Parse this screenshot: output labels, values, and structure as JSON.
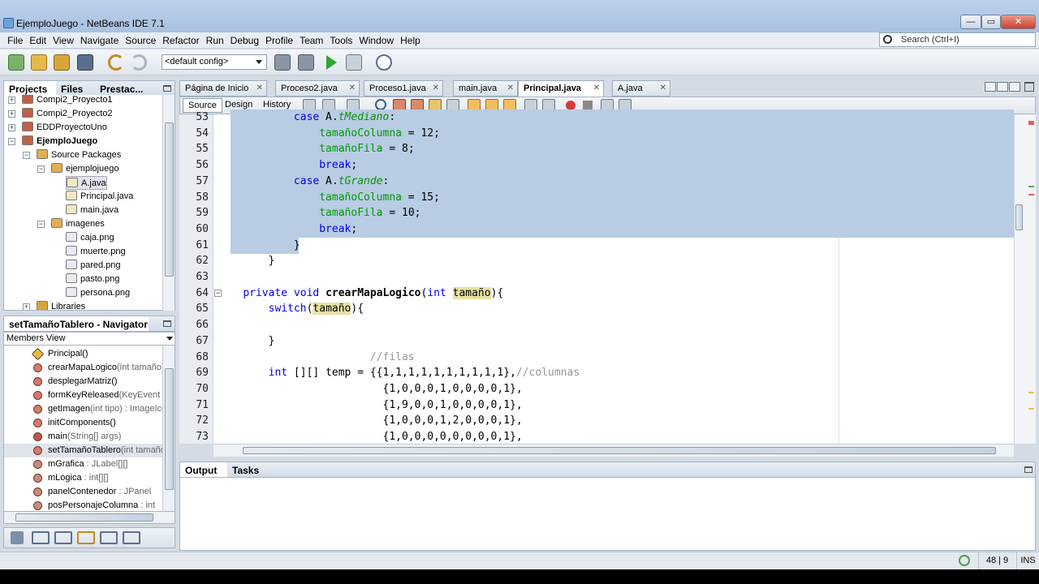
{
  "window": {
    "title": "EjemploJuego - NetBeans IDE 7.1",
    "minimize": "—",
    "maximize": "▭",
    "close": "✕"
  },
  "menu": [
    "File",
    "Edit",
    "View",
    "Navigate",
    "Source",
    "Refactor",
    "Run",
    "Debug",
    "Profile",
    "Team",
    "Tools",
    "Window",
    "Help"
  ],
  "search": {
    "placeholder": "Search (Ctrl+I)"
  },
  "toolbar": {
    "config": "<default config>"
  },
  "projects_panel": {
    "tabs": [
      "Projects",
      "Files",
      "Prestac..."
    ],
    "tree": [
      {
        "label": "Compi2_Proyecto1",
        "level": 0,
        "expander": "+",
        "icon": "project-icon"
      },
      {
        "label": "Compi2_Proyecto2",
        "level": 0,
        "expander": "+",
        "icon": "project-icon"
      },
      {
        "label": "EDDProyectoUno",
        "level": 0,
        "expander": "+",
        "icon": "project-icon"
      },
      {
        "label": "EjemploJuego",
        "level": 0,
        "expander": "−",
        "icon": "project-icon",
        "bold": true
      },
      {
        "label": "Source Packages",
        "level": 1,
        "expander": "−",
        "icon": "source-packages-icon"
      },
      {
        "label": "ejemplojuego",
        "level": 2,
        "expander": "−",
        "icon": "package-icon"
      },
      {
        "label": "A.java",
        "level": 3,
        "expander": "",
        "icon": "java-file-icon",
        "selected": true
      },
      {
        "label": "Principal.java",
        "level": 3,
        "expander": "",
        "icon": "java-file-icon"
      },
      {
        "label": "main.java",
        "level": 3,
        "expander": "",
        "icon": "java-file-icon"
      },
      {
        "label": "imagenes",
        "level": 2,
        "expander": "−",
        "icon": "package-icon"
      },
      {
        "label": "caja.png",
        "level": 3,
        "expander": "",
        "icon": "image-file-icon"
      },
      {
        "label": "muerte.png",
        "level": 3,
        "expander": "",
        "icon": "image-file-icon"
      },
      {
        "label": "pared.png",
        "level": 3,
        "expander": "",
        "icon": "image-file-icon"
      },
      {
        "label": "pasto.png",
        "level": 3,
        "expander": "",
        "icon": "image-file-icon"
      },
      {
        "label": "persona.png",
        "level": 3,
        "expander": "",
        "icon": "image-file-icon"
      },
      {
        "label": "Libraries",
        "level": 1,
        "expander": "+",
        "icon": "libraries-icon"
      }
    ]
  },
  "navigator": {
    "title": "setTamañoTablero - Navigator",
    "view": "Members View",
    "members": [
      {
        "name": "Principal()",
        "type": "",
        "icon": "constructor-icon"
      },
      {
        "name": "crearMapaLogico",
        "type": "(int tamaño)",
        "icon": "method-icon"
      },
      {
        "name": "desplegarMatriz()",
        "type": "",
        "icon": "method-icon"
      },
      {
        "name": "formKeyReleased",
        "type": "(KeyEvent evt)",
        "icon": "method-icon"
      },
      {
        "name": "getImagen",
        "type": "(int tipo) : ImageIcon",
        "icon": "method-icon"
      },
      {
        "name": "initComponents()",
        "type": "",
        "icon": "method-icon"
      },
      {
        "name": "main",
        "type": "(String[] args)",
        "icon": "static-method-icon"
      },
      {
        "name": "setTamañoTablero",
        "type": "(int tamaño)",
        "icon": "method-icon",
        "selected": true
      },
      {
        "name": "mGrafica",
        "type": " : JLabel[][]",
        "icon": "field-icon"
      },
      {
        "name": "mLogica",
        "type": " : int[][]",
        "icon": "field-icon"
      },
      {
        "name": "panelContenedor",
        "type": " : JPanel",
        "icon": "field-icon"
      },
      {
        "name": "posPersonajeColumna",
        "type": " : int",
        "icon": "field-icon"
      }
    ]
  },
  "editor": {
    "tabs": [
      {
        "label": "Página de Inicio",
        "active": false
      },
      {
        "label": "Proceso2.java",
        "active": false
      },
      {
        "label": "Proceso1.java",
        "active": false
      },
      {
        "label": "main.java",
        "active": false
      },
      {
        "label": "Principal.java",
        "active": true
      },
      {
        "label": "A.java",
        "active": false
      }
    ],
    "views": [
      "Source",
      "Design",
      "History"
    ],
    "lines": [
      {
        "n": "53",
        "selected": true,
        "html": "            <span class=\"kw\">case</span> A.<span class=\"st\">tMediano</span>:"
      },
      {
        "n": "54",
        "selected": true,
        "html": "                <span class=\"fld\">tamañoColumna</span> = 12;"
      },
      {
        "n": "55",
        "selected": true,
        "html": "                <span class=\"fld\">tamañoFila</span> = 8;"
      },
      {
        "n": "56",
        "selected": true,
        "html": "                <span class=\"kw\">break</span>;"
      },
      {
        "n": "57",
        "selected": true,
        "html": "            <span class=\"kw\">case</span> A.<span class=\"st\">tGrande</span>:"
      },
      {
        "n": "58",
        "selected": true,
        "html": "                <span class=\"fld\">tamañoColumna</span> = 15;"
      },
      {
        "n": "59",
        "selected": true,
        "html": "                <span class=\"fld\">tamañoFila</span> = 10;"
      },
      {
        "n": "60",
        "selected": true,
        "html": "                <span class=\"kw\">break</span>;"
      },
      {
        "n": "61",
        "selected": "partial",
        "html": "            }"
      },
      {
        "n": "62",
        "selected": false,
        "html": "        }"
      },
      {
        "n": "63",
        "selected": false,
        "html": ""
      },
      {
        "n": "64",
        "selected": false,
        "fold": true,
        "html": "    <span class=\"kw\">private</span> <span class=\"kw\">void</span> <span class=\"bold\">crearMapaLogico</span>(<span class=\"kw\">int</span> <span class=\"hl\">tamaño</span>){"
      },
      {
        "n": "65",
        "selected": false,
        "html": "        <span class=\"kw\">switch</span>(<span class=\"hl\">tamaño</span>){"
      },
      {
        "n": "66",
        "selected": false,
        "html": ""
      },
      {
        "n": "67",
        "selected": false,
        "html": "        }"
      },
      {
        "n": "68",
        "selected": false,
        "html": "                        <span class=\"cm\">//filas</span>"
      },
      {
        "n": "69",
        "selected": false,
        "html": "        <span class=\"kw\">int</span> [][] temp = {{1,1,1,1,1,1,1,1,1,1},<span class=\"cm\">//columnas</span>"
      },
      {
        "n": "70",
        "selected": false,
        "html": "                          {1,0,0,0,1,0,0,0,0,1},"
      },
      {
        "n": "71",
        "selected": false,
        "html": "                          {1,9,0,0,1,0,0,0,0,1},"
      },
      {
        "n": "72",
        "selected": false,
        "html": "                          {1,0,0,0,1,2,0,0,0,1},"
      },
      {
        "n": "73",
        "selected": false,
        "html": "                          {1,0,0,0,0,0,0,0,0,1},"
      }
    ]
  },
  "output": {
    "tabs": [
      "Output",
      "Tasks"
    ]
  },
  "status": {
    "position": "48 | 9",
    "mode": "INS"
  },
  "colors": {
    "selection": "#b8cce4",
    "keyword": "#0000e6",
    "field": "#009900",
    "comment": "#969696"
  }
}
